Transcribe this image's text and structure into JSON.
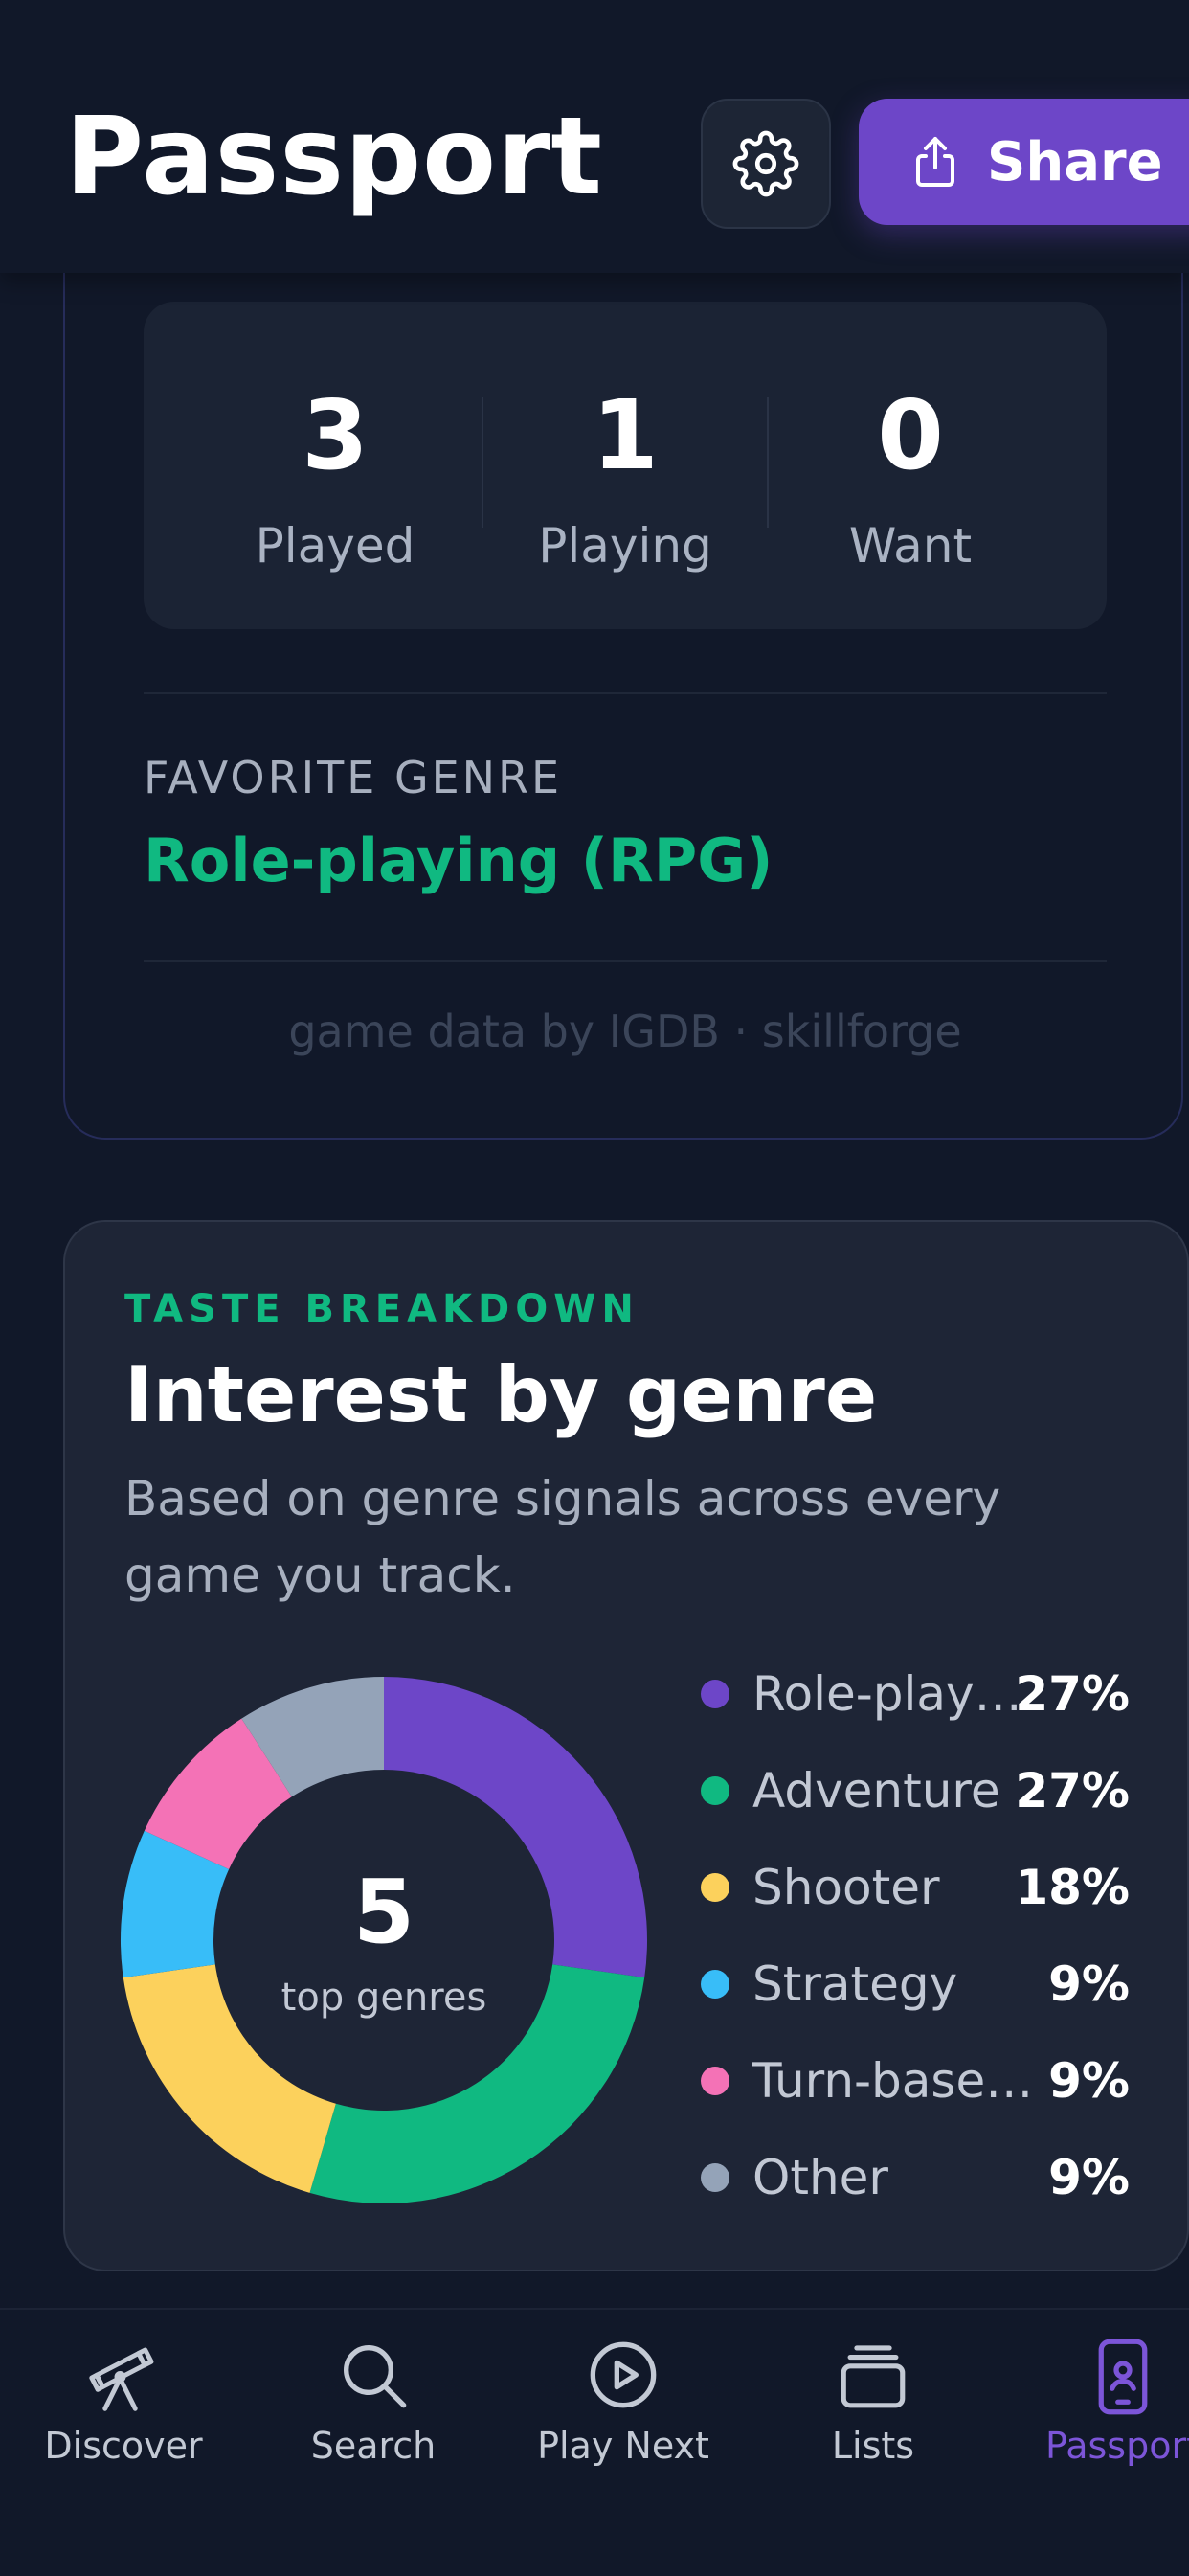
{
  "header": {
    "title": "Passport",
    "share_label": "Share"
  },
  "stats": [
    {
      "value": "3",
      "label": "Played"
    },
    {
      "value": "1",
      "label": "Playing"
    },
    {
      "value": "0",
      "label": "Want"
    }
  ],
  "favorite": {
    "label": "FAVORITE GENRE",
    "value": "Role-playing (RPG)"
  },
  "credit": "game data by IGDB · skillforge",
  "taste": {
    "eyebrow": "TASTE BREAKDOWN",
    "title": "Interest by genre",
    "description": "Based on genre signals across every game you track.",
    "center_value": "5",
    "center_label": "top genres"
  },
  "chart_data": {
    "type": "pie",
    "categories": [
      "Role-play…",
      "Adventure",
      "Shooter",
      "Strategy",
      "Turn-base…",
      "Other"
    ],
    "values": [
      27,
      27,
      18,
      9,
      9,
      9
    ],
    "value_labels": [
      "27%",
      "27%",
      "18%",
      "9%",
      "9%",
      "9%"
    ],
    "colors": [
      "#6d46c8",
      "#10b981",
      "#fcd15c",
      "#38bdf8",
      "#f472b6",
      "#94a3b8"
    ],
    "legend_position": "right"
  },
  "tabs": [
    {
      "label": "Discover",
      "icon": "telescope-icon",
      "active": false
    },
    {
      "label": "Search",
      "icon": "search-icon",
      "active": false
    },
    {
      "label": "Play Next",
      "icon": "play-circle-icon",
      "active": false
    },
    {
      "label": "Lists",
      "icon": "stack-icon",
      "active": false
    },
    {
      "label": "Passport",
      "icon": "phone-badge-icon",
      "active": true
    }
  ],
  "colors": {
    "accent": "#6d46c8",
    "green": "#10b981",
    "background": "#111829",
    "card": "#1e2536"
  }
}
